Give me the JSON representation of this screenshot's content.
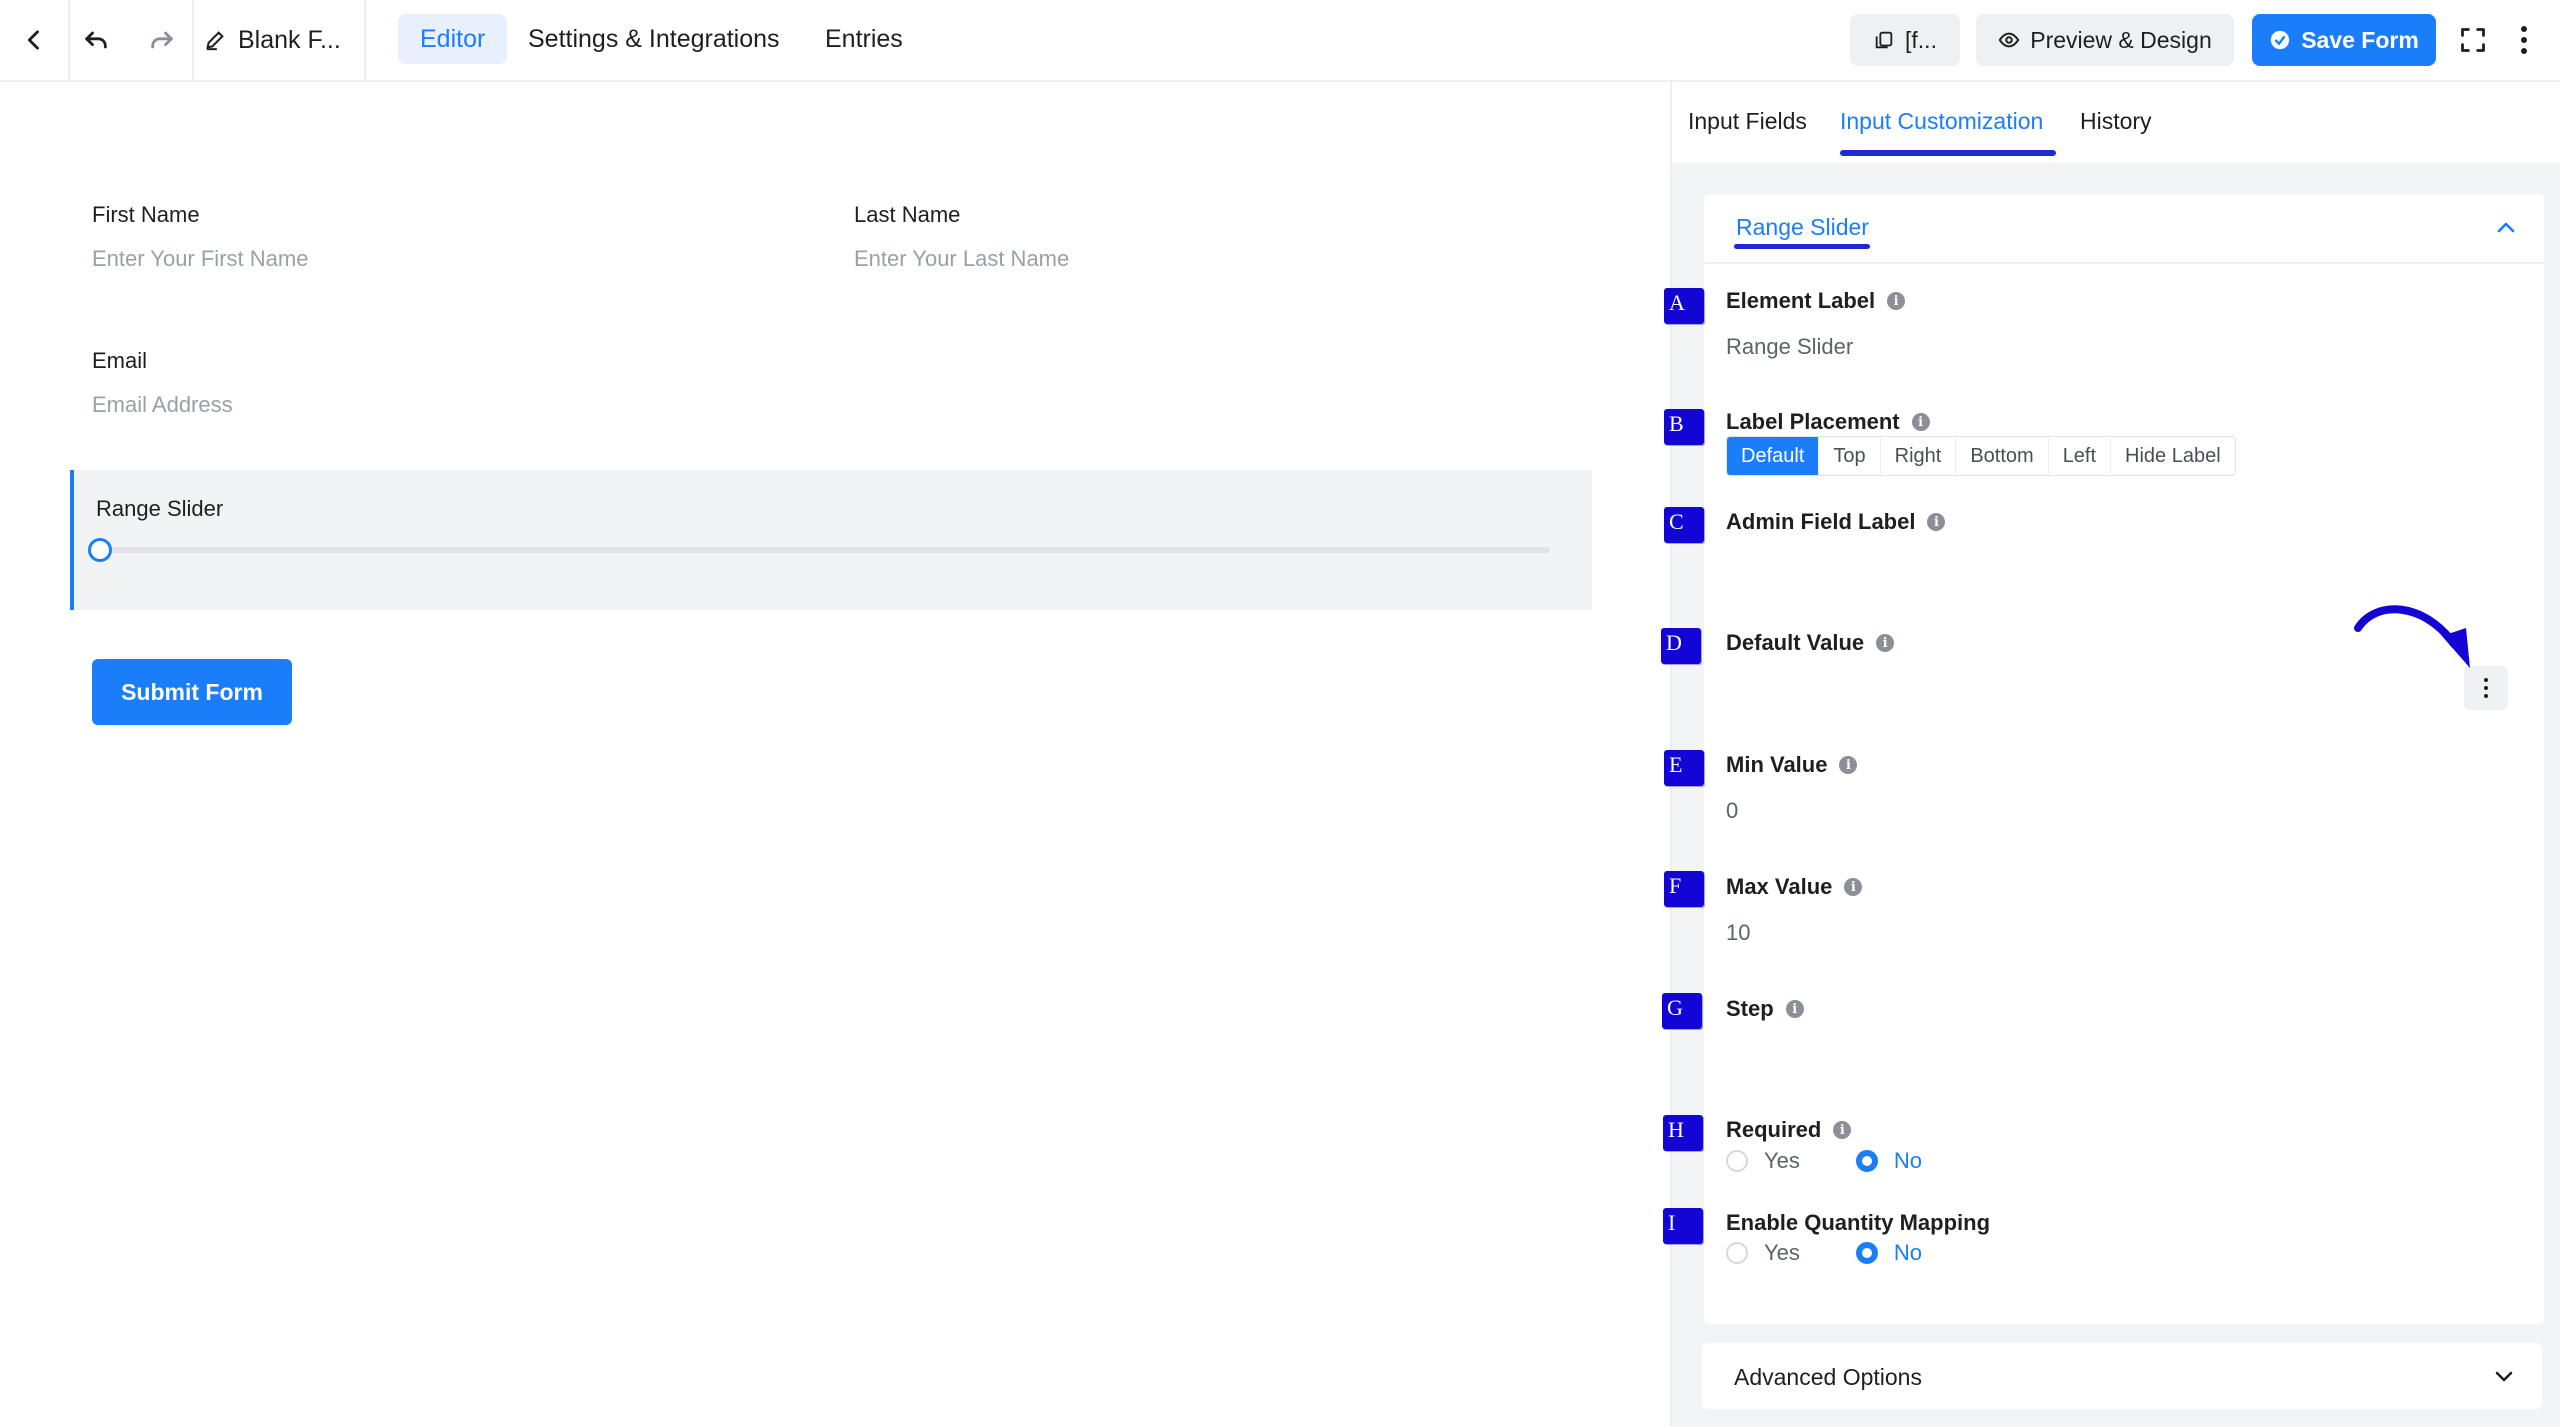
{
  "topbar": {
    "form_title": "Blank F...",
    "tabs": [
      {
        "label": "Editor",
        "active": true
      },
      {
        "label": "Settings & Integrations",
        "active": false
      },
      {
        "label": "Entries",
        "active": false
      }
    ],
    "shortcode_label": "[f...",
    "preview_label": "Preview & Design",
    "save_label": "Save Form"
  },
  "form": {
    "first_name": {
      "label": "First Name",
      "placeholder": "Enter Your First Name"
    },
    "last_name": {
      "label": "Last Name",
      "placeholder": "Enter Your Last Name"
    },
    "email": {
      "label": "Email",
      "placeholder": "Email Address"
    },
    "range_slider": {
      "label": "Range Slider",
      "value_fraction": 0
    },
    "submit_label": "Submit Form"
  },
  "panel": {
    "tabs": [
      {
        "label": "Input Fields",
        "active": false
      },
      {
        "label": "Input Customization",
        "active": true
      },
      {
        "label": "History",
        "active": false
      }
    ],
    "section_title": "Range Slider",
    "settings": {
      "element_label": {
        "marker": "A",
        "label": "Element Label",
        "value": "Range Slider"
      },
      "label_placement": {
        "marker": "B",
        "label": "Label Placement",
        "options": [
          "Default",
          "Top",
          "Right",
          "Bottom",
          "Left",
          "Hide Label"
        ],
        "selected": "Default"
      },
      "admin_field_label": {
        "marker": "C",
        "label": "Admin Field Label",
        "value": ""
      },
      "default_value": {
        "marker": "D",
        "label": "Default Value",
        "value": ""
      },
      "min_value": {
        "marker": "E",
        "label": "Min Value",
        "value": "0"
      },
      "max_value": {
        "marker": "F",
        "label": "Max Value",
        "value": "10"
      },
      "step": {
        "marker": "G",
        "label": "Step",
        "value": ""
      },
      "required": {
        "marker": "H",
        "label": "Required",
        "yes": "Yes",
        "no": "No",
        "selected": "No"
      },
      "quantity_mapping": {
        "marker": "I",
        "label": "Enable Quantity Mapping",
        "yes": "Yes",
        "no": "No",
        "selected": "No"
      }
    },
    "advanced_options": "Advanced Options"
  },
  "colors": {
    "accent": "#1a7efb",
    "annotation": "#1205d6"
  }
}
